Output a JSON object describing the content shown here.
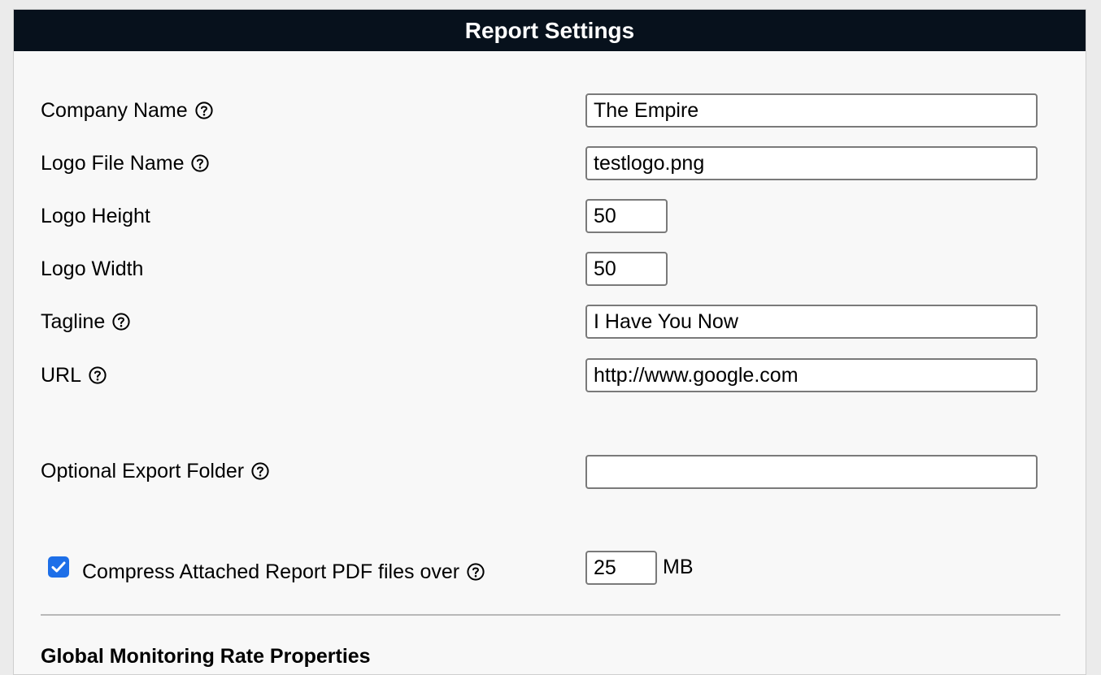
{
  "title": "Report Settings",
  "fields": {
    "company_name": {
      "label": "Company Name",
      "value": "The Empire"
    },
    "logo_file_name": {
      "label": "Logo File Name",
      "value": "testlogo.png"
    },
    "logo_height": {
      "label": "Logo Height",
      "value": "50"
    },
    "logo_width": {
      "label": "Logo Width",
      "value": "50"
    },
    "tagline": {
      "label": "Tagline",
      "value": "I Have You Now"
    },
    "url": {
      "label": "URL",
      "value": "http://www.google.com"
    },
    "export_folder": {
      "label": "Optional Export Folder",
      "value": ""
    }
  },
  "compress": {
    "label": "Compress Attached Report PDF files over",
    "checked": true,
    "value": "25",
    "unit": "MB"
  },
  "next_section": {
    "title": "Global Monitoring Rate Properties"
  },
  "colors": {
    "header_bg": "#07111c",
    "checkbox": "#1d6fe8"
  }
}
